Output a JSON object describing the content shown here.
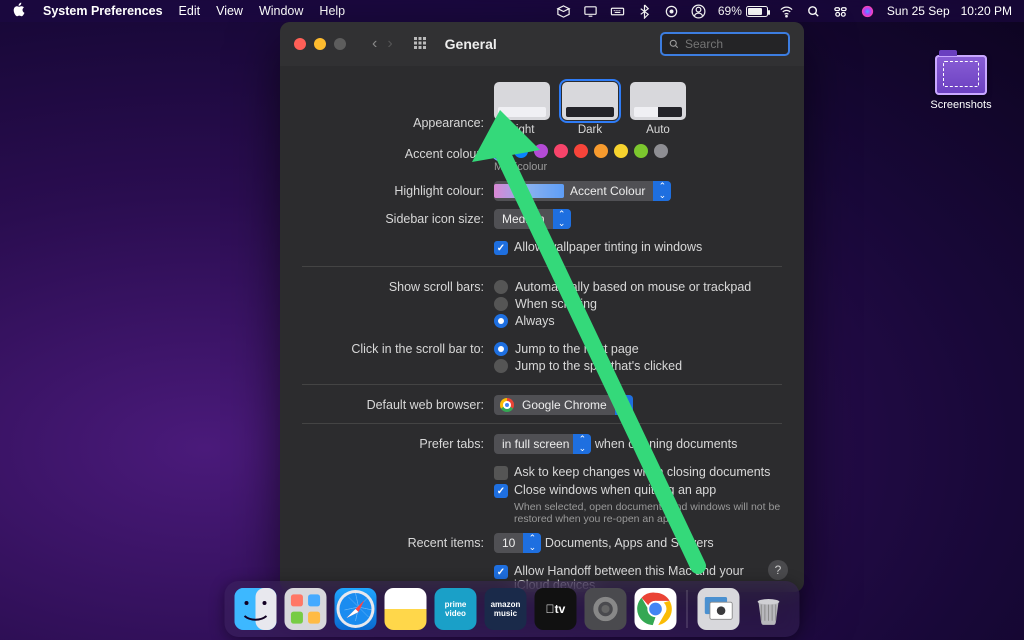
{
  "menubar": {
    "app": "System Preferences",
    "items": [
      "Edit",
      "View",
      "Window",
      "Help"
    ],
    "battery_pct": "69%",
    "day_date": "Sun 25 Sep",
    "time": "10:20 PM"
  },
  "desktop": {
    "folder_label": "Screenshots"
  },
  "window": {
    "title": "General",
    "search_placeholder": "Search",
    "labels": {
      "appearance": "Appearance:",
      "accent": "Accent colour:",
      "accent_sub": "Multicolour",
      "highlight": "Highlight colour:",
      "highlight_val": "Accent Colour",
      "sidebar": "Sidebar icon size:",
      "sidebar_val": "Medium",
      "wallpaper_tint": "Allow wallpaper tinting in windows",
      "scrollbars": "Show scroll bars:",
      "scroll_auto": "Automatically based on mouse or trackpad",
      "scroll_when": "When scrolling",
      "scroll_always": "Always",
      "click_scroll": "Click in the scroll bar to:",
      "click_next": "Jump to the next page",
      "click_spot": "Jump to the spot that's clicked",
      "browser": "Default web browser:",
      "browser_val": "Google Chrome",
      "prefer_tabs": "Prefer tabs:",
      "tabs_val": "in full screen",
      "tabs_suffix": " when opening documents",
      "ask_keep": "Ask to keep changes when closing documents",
      "close_quit": "Close windows when quitting an app",
      "close_sub": "When selected, open documents and windows will not be restored when you re-open an app.",
      "recent": "Recent items:",
      "recent_val": "10",
      "recent_suffix": " Documents, Apps and Servers",
      "handoff": "Allow Handoff between this Mac and your iCloud devices"
    },
    "appearance_options": [
      "Light",
      "Dark",
      "Auto"
    ],
    "accent_colors": [
      "#f44",
      "#0a84ff",
      "#b44bd6",
      "#f76",
      "#f7446a",
      "#f79b2e",
      "#f7d32e",
      "#7cc72e",
      "#8e8e93"
    ]
  },
  "dock": {
    "apps": [
      "Finder",
      "Launchpad",
      "Safari",
      "Notes",
      "prime video",
      "amazon music",
      "Apple TV",
      "Settings",
      "Chrome",
      "Preview",
      "Trash"
    ]
  }
}
